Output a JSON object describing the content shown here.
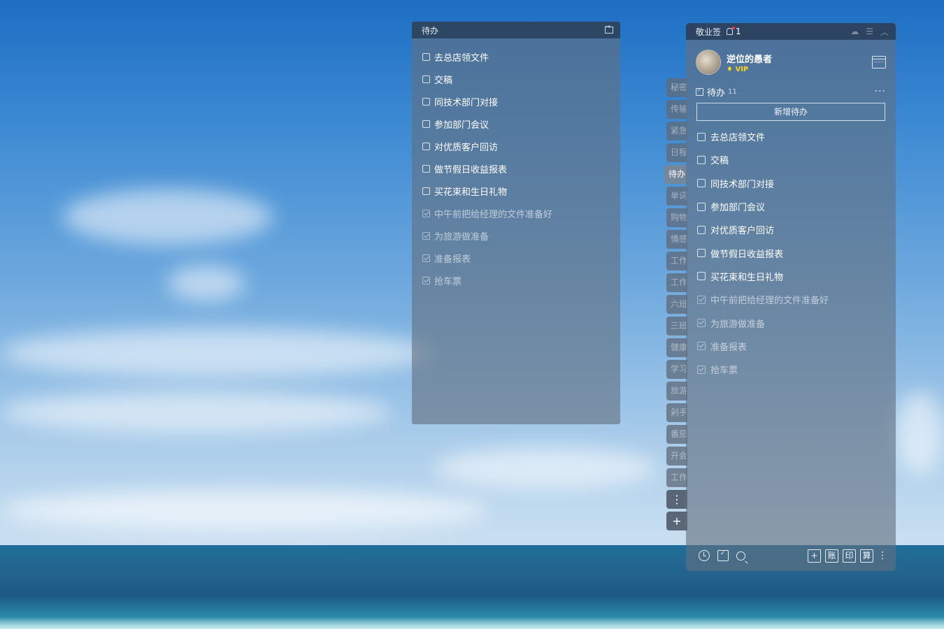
{
  "widget": {
    "title": "待办",
    "items": [
      {
        "text": "去总店领文件",
        "done": false
      },
      {
        "text": "交稿",
        "done": false
      },
      {
        "text": "同技术部门对接",
        "done": false
      },
      {
        "text": "参加部门会议",
        "done": false
      },
      {
        "text": "对优质客户回访",
        "done": false
      },
      {
        "text": "做节假日收益报表",
        "done": false
      },
      {
        "text": "买花束和生日礼物",
        "done": false
      },
      {
        "text": "中午前把给经理的文件准备好",
        "done": true
      },
      {
        "text": "为旅游做准备",
        "done": true
      },
      {
        "text": "准备报表",
        "done": true
      },
      {
        "text": "抢车票",
        "done": true
      }
    ]
  },
  "tabs": [
    {
      "label": "秘密"
    },
    {
      "label": "传输"
    },
    {
      "label": "紧急"
    },
    {
      "label": "日程"
    },
    {
      "label": "待办"
    },
    {
      "label": "单词"
    },
    {
      "label": "购物"
    },
    {
      "label": "情感"
    },
    {
      "label": "工作"
    },
    {
      "label": "工作"
    },
    {
      "label": "六班"
    },
    {
      "label": "三班"
    },
    {
      "label": "健康"
    },
    {
      "label": "学习"
    },
    {
      "label": "旅游"
    },
    {
      "label": "剁手"
    },
    {
      "label": "番茄"
    },
    {
      "label": "开会"
    },
    {
      "label": "工作"
    }
  ],
  "tab_buttons": {
    "more": "⋮",
    "add": "+"
  },
  "app": {
    "title": "敬业签",
    "notification_count": "1",
    "user": {
      "name": "逆位的愚者",
      "badge": "VIP"
    },
    "section": {
      "label": "待办",
      "count": "11",
      "new_button": "新增待办"
    },
    "items": [
      {
        "text": "去总店领文件",
        "done": false
      },
      {
        "text": "交稿",
        "done": false
      },
      {
        "text": "同技术部门对接",
        "done": false
      },
      {
        "text": "参加部门会议",
        "done": false
      },
      {
        "text": "对优质客户回访",
        "done": false
      },
      {
        "text": "做节假日收益报表",
        "done": false
      },
      {
        "text": "买花束和生日礼物",
        "done": false
      },
      {
        "text": "中午前把给经理的文件准备好",
        "done": true
      },
      {
        "text": "为旅游做准备",
        "done": true
      },
      {
        "text": "准备报表",
        "done": true
      },
      {
        "text": "抢车票",
        "done": true
      }
    ],
    "footer": {
      "add": "+",
      "account": "账",
      "print": "印",
      "calc": "算"
    }
  }
}
